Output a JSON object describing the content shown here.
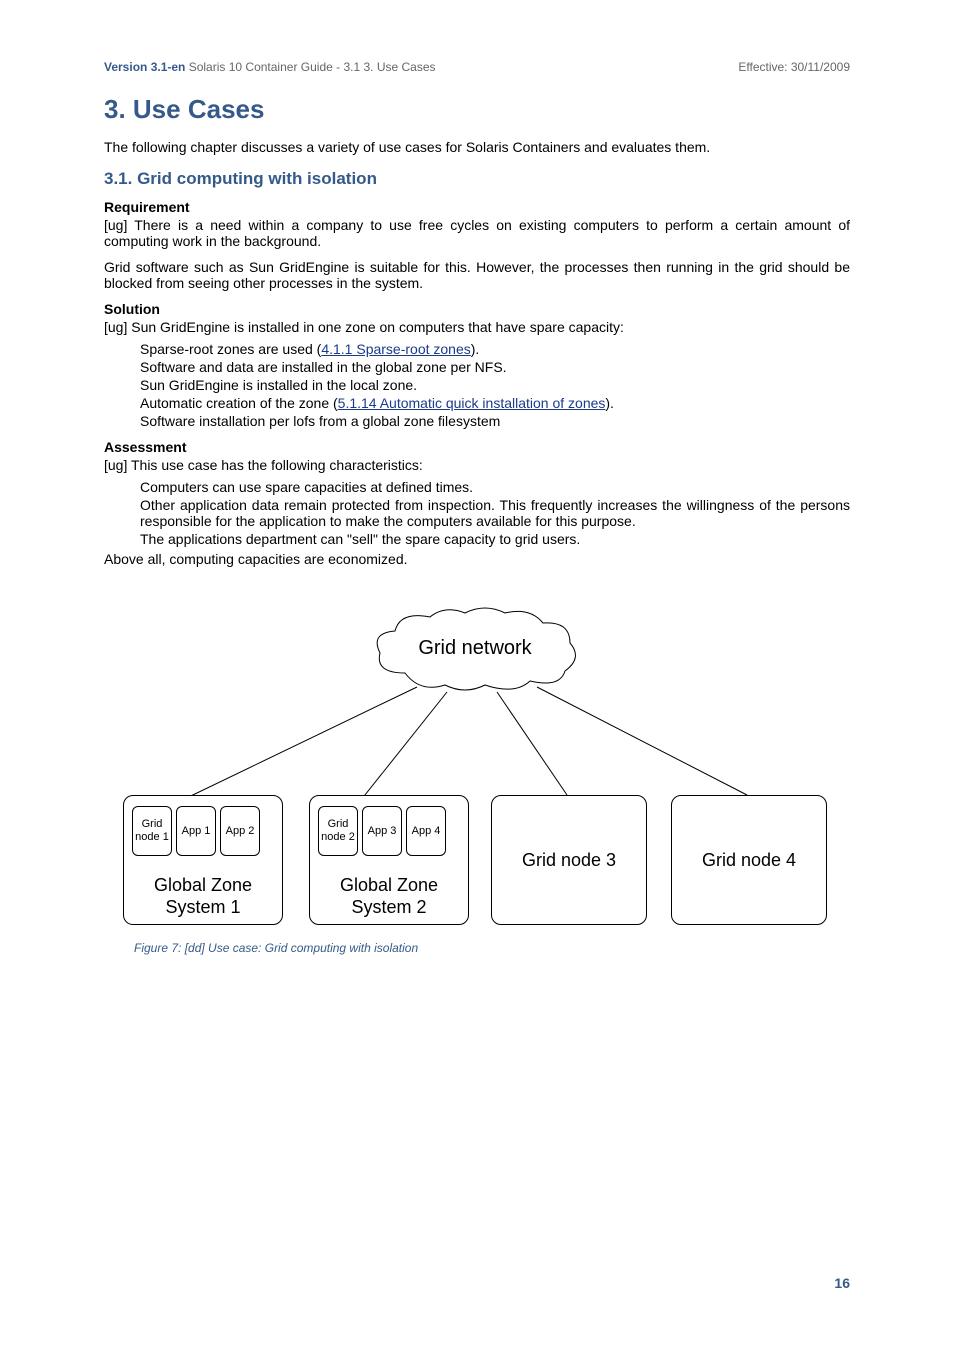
{
  "header": {
    "version_label": "Version 3.1-en",
    "breadcrumb": "  Solaris 10 Container Guide - 3.1  3. Use Cases",
    "effective": "Effective: 30/11/2009"
  },
  "title": "3. Use Cases",
  "intro": "The following chapter discusses a variety of use cases for Solaris Containers and evaluates them.",
  "section_3_1": {
    "heading": "3.1. Grid computing with isolation",
    "requirement_head": "Requirement",
    "requirement_body": "[ug] There is a need within a company to use free cycles on existing computers to perform a certain amount of computing work in the background.",
    "requirement_body2": "Grid software such as Sun GridEngine is suitable for this. However, the processes then running in the grid should be blocked from seeing other processes in the system.",
    "solution_head": "Solution",
    "solution_intro": "[ug] Sun GridEngine is installed in one zone on computers that have spare capacity:",
    "solution_items": [
      {
        "pre": "Sparse-root zones are used (",
        "link": "4.1.1 Sparse-root zones",
        "post": ")."
      },
      {
        "pre": "Software and data are installed in the global zone per NFS.",
        "link": "",
        "post": ""
      },
      {
        "pre": "Sun GridEngine is installed in the local zone.",
        "link": "",
        "post": ""
      },
      {
        "pre": "Automatic creation of the zone (",
        "link": "5.1.14 Automatic quick installation of zones",
        "post": ")."
      },
      {
        "pre": "Software installation per lofs from a global zone filesystem",
        "link": "",
        "post": ""
      }
    ],
    "assessment_head": "Assessment",
    "assessment_intro": "[ug] This use case has the following characteristics:",
    "assessment_items": [
      "Computers can use spare capacities at defined times.",
      "Other application data remain protected from inspection. This frequently increases the willingness of the persons responsible for the application to make the computers available for this purpose.",
      "The applications department can \"sell\" the spare capacity to grid users."
    ],
    "assessment_tail": "Above all, computing capacities are economized."
  },
  "figure": {
    "cloud_label": "Grid network",
    "sys1": {
      "nodes": [
        "Grid node 1",
        "App 1",
        "App 2"
      ],
      "label_line1": "Global Zone",
      "label_line2": "System 1"
    },
    "sys2": {
      "nodes": [
        "Grid node 2",
        "App 3",
        "App 4"
      ],
      "label_line1": "Global Zone",
      "label_line2": "System 2"
    },
    "node3": "Grid node 3",
    "node4": "Grid node 4",
    "caption": "Figure 7: [dd] Use case: Grid computing with isolation"
  },
  "page_number": "16"
}
